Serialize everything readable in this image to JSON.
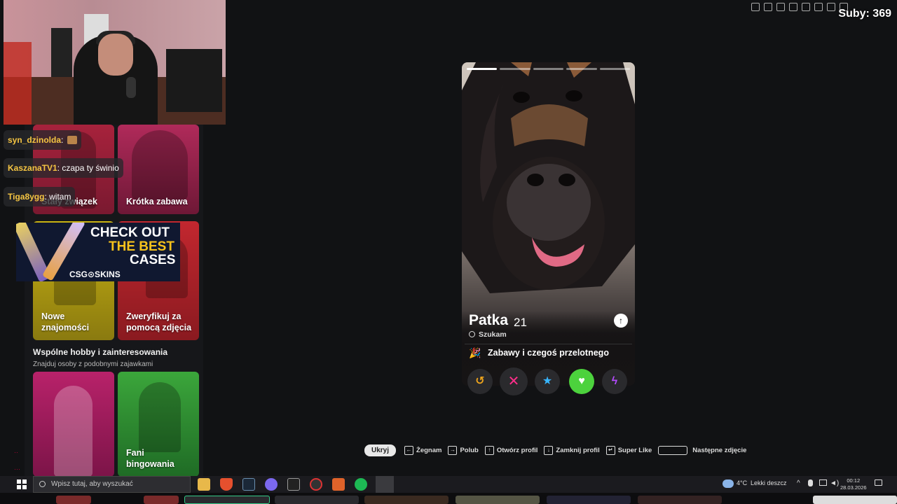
{
  "overlay": {
    "subs_text": "Suby: 369"
  },
  "left_panel": {
    "tiles": [
      {
        "label": "Stały związek"
      },
      {
        "label": "Krótka zabawa"
      },
      {
        "label": "Nowe znajomości"
      },
      {
        "label": "Zweryfikuj za pomocą zdjęcia"
      },
      {
        "label": ""
      },
      {
        "label": "Fani bingowania"
      }
    ],
    "section_title": "Wspólne hobby i zainteresowania",
    "section_subtitle": "Znajduj osoby z podobnymi zajawkami"
  },
  "chat": {
    "messages": [
      {
        "user": "syn_dzinolda",
        "text": ""
      },
      {
        "user": "KaszanaTV1",
        "text": "czapa ty świnio"
      },
      {
        "user": "Tiga8ygg",
        "text": "witam"
      }
    ]
  },
  "ad": {
    "line1": "CHECK OUT",
    "line2": "THE BEST",
    "line3": "CASES",
    "brand": "CSG⊙SKINS"
  },
  "profile": {
    "name": "Patka",
    "age": "21",
    "looking_label": "Szukam",
    "goal_emoji": "🎉",
    "goal": "Zabawy i czegoś przelotnego",
    "photo_count": 5,
    "active_photo": 1
  },
  "actions": {
    "rewind_icon": "↺",
    "nope_icon": "✕",
    "superlike_icon": "★",
    "like_icon": "♥",
    "boost_icon": "ϟ"
  },
  "shortcuts": {
    "hide": "Ukryj",
    "items": [
      {
        "key": "←",
        "label": "Żegnam"
      },
      {
        "key": "→",
        "label": "Polub"
      },
      {
        "key": "↑",
        "label": "Otwórz profil"
      },
      {
        "key": "↓",
        "label": "Zamknij profil"
      },
      {
        "key": "↵",
        "label": "Super Like"
      },
      {
        "key": "",
        "label": "Następne zdjęcie"
      }
    ]
  },
  "taskbar": {
    "search_placeholder": "Wpisz tutaj, aby wyszukać",
    "weather_temp": "4°C",
    "weather_desc": "Lekki deszcz",
    "time": "00:12",
    "date": "28.03.2026"
  },
  "colors": {
    "like": "#4cd23d",
    "nope": "#ff2e8a",
    "superlike": "#38b6ff",
    "boost": "#b54bff",
    "rewind": "#f0a51c",
    "chat_user": "#f5c542"
  }
}
